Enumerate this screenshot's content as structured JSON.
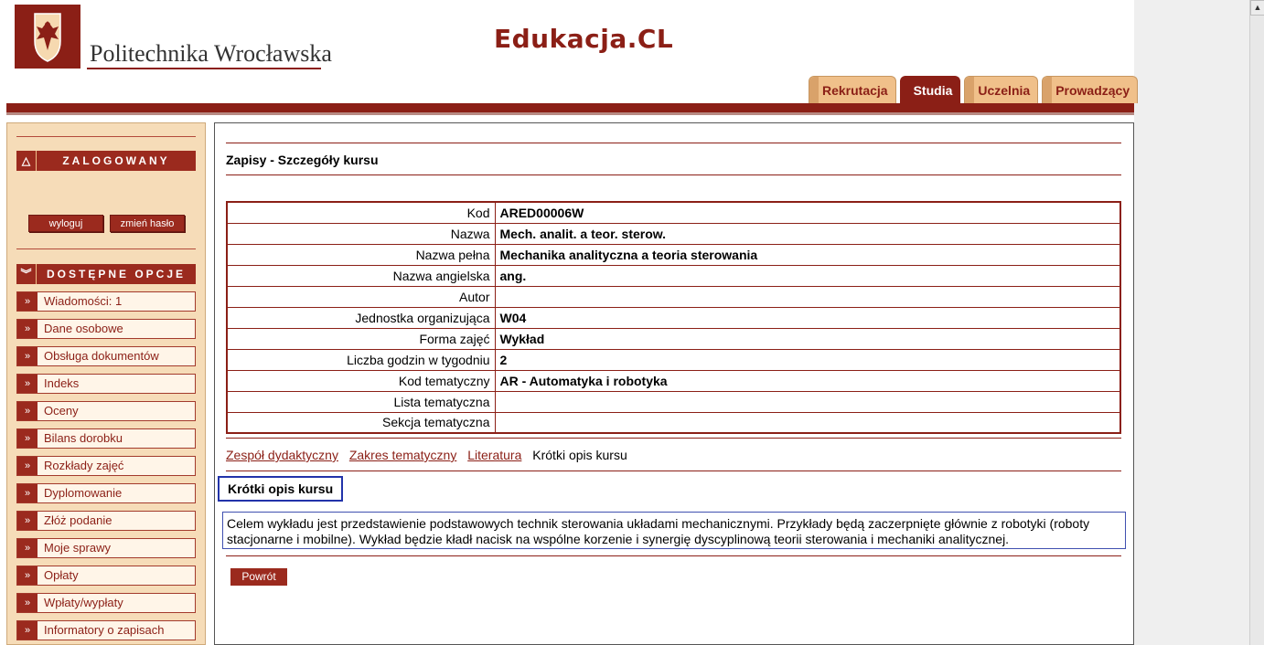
{
  "header": {
    "university_name": "Politechnika Wrocławska",
    "app_title": "Edukacja.CL",
    "tabs": [
      {
        "label": "Rekrutacja",
        "active": false
      },
      {
        "label": "Studia",
        "active": true
      },
      {
        "label": "Uczelnia",
        "active": false
      },
      {
        "label": "Prowadzący",
        "active": false
      }
    ]
  },
  "sidebar": {
    "logged_header": "ZALOGOWANY",
    "logout_label": "wyloguj",
    "change_password_label": "zmień hasło",
    "options_header": "DOSTĘPNE OPCJE",
    "items": [
      {
        "label": "Wiadomości: 1"
      },
      {
        "label": "Dane osobowe"
      },
      {
        "label": "Obsługa dokumentów"
      },
      {
        "label": "Indeks"
      },
      {
        "label": "Oceny"
      },
      {
        "label": "Bilans dorobku"
      },
      {
        "label": "Rozkłady zajęć"
      },
      {
        "label": "Dyplomowanie"
      },
      {
        "label": "Złóż podanie"
      },
      {
        "label": "Moje sprawy"
      },
      {
        "label": "Opłaty"
      },
      {
        "label": "Wpłaty/wypłaty"
      },
      {
        "label": "Informatory o zapisach"
      }
    ]
  },
  "main": {
    "title": "Zapisy - Szczegóły kursu",
    "rows": [
      {
        "label": "Kod",
        "value": "ARED00006W"
      },
      {
        "label": "Nazwa",
        "value": "Mech. analit. a teor. sterow."
      },
      {
        "label": "Nazwa pełna",
        "value": "Mechanika analityczna a teoria sterowania"
      },
      {
        "label": "Nazwa angielska",
        "value": "ang."
      },
      {
        "label": "Autor",
        "value": ""
      },
      {
        "label": "Jednostka organizująca",
        "value": "W04"
      },
      {
        "label": "Forma zajęć",
        "value": "Wykład"
      },
      {
        "label": "Liczba godzin w tygodniu",
        "value": "2"
      },
      {
        "label": "Kod tematyczny",
        "value": "AR - Automatyka i robotyka"
      },
      {
        "label": "Lista tematyczna",
        "value": ""
      },
      {
        "label": "Sekcja tematyczna",
        "value": ""
      }
    ],
    "sublinks": [
      "Zespół dydaktyczny",
      "Zakres tematyczny",
      "Literatura"
    ],
    "current_section": "Krótki opis kursu",
    "section_title": "Krótki opis kursu",
    "description": "Celem wykładu jest przedstawienie podstawowych technik sterowania układami mechanicznymi. Przykłady będą zaczerpnięte głównie z robotyki (roboty stacjonarne i mobilne). Wykład będzie kładł nacisk na wspólne korzenie i synergię dyscyplinową teorii sterowania i mechaniki analitycznej.",
    "back_label": "Powrót"
  },
  "colors": {
    "brand": "#8b1f16",
    "sidebar_bg": "#f6dcb8",
    "tab_inactive": "#f0c08a",
    "section_border": "#2233aa"
  }
}
